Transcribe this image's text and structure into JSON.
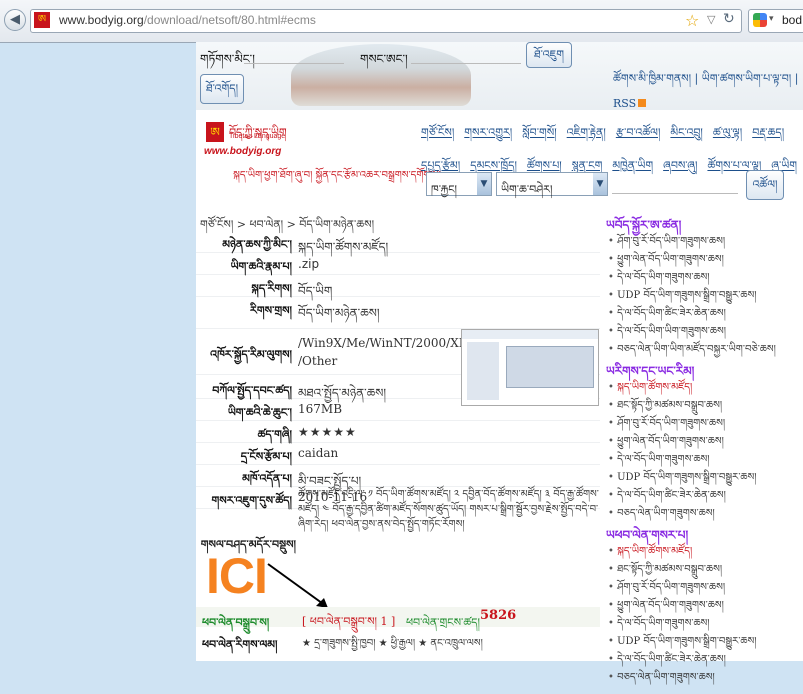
{
  "browser": {
    "url_host": "www.bodyig.org",
    "url_path": "/download/netsoft/80.html#ecms",
    "search_text": "bod",
    "favicon_glyph": "ཨ"
  },
  "header": {
    "user_label": "གཏོགས་མིང་།",
    "pass_label": "གསང་ཨང་།",
    "login_btn": "ཐོ་འཇུག",
    "register_btn": "ཐོ་འགོད།",
    "toplinks": "ཚོགས་མི་ཁྱིམ་གནས། | ཡིག་ཚགས་ཡིག་པ་ལྟ་བ། | RSS"
  },
  "logo": {
    "mark": "ཨ",
    "title": "བོད་ཀྱི་སྐད་ཡིག",
    "subtitle": "Tibetan Language",
    "url": "www.bodyig.org"
  },
  "nav": {
    "row1": [
      "གཙོ་ངོས།",
      "གསར་འགྱུར།",
      "སློབ་གསོ།",
      "འཇིག་རྟེན།",
      "རྩ་བ་འཚོལ།",
      "མིང་འབྲུ།",
      "ཚ་ལུ་ལྟ།",
      "བརྡ་ཆད།"
    ],
    "row2": [
      "དཔྱད་རྩོམ།",
      "དམངས་ཁྲོད།",
      "ཚོགས་པ།",
      "སྙན་ངག",
      "མཁྱེན་ཡིག",
      "ཞབས་ཞུ།",
      "ཚོགས་པ་ལ་ལྟ།",
      "ཞུ་ཡིག"
    ]
  },
  "announcement": "སྐད་ཡིག་ཕྱག་ཐོག་ཞུ་བ། སྐྱོན་དང་རྩོམ་འཆར་བསྒྲགས་དགོས་པ།",
  "search": {
    "cat_value": "ཁ་རྐྱང།",
    "field_value": "ཡིག་ཆ་བཤེར།",
    "go_btn": "འཚོལ།"
  },
  "breadcrumb": "གཙོ་ངོས། > ཕབ་ལེན། > བོད་ཡིག་མཉེན་ཆས།",
  "details": {
    "rows": [
      {
        "k": "མཉེན་ཆས་ཀྱི་མིང་།",
        "v": "སྐད་ཡིག་ཚོགས་མཛོད།"
      },
      {
        "k": "ཡིག་ཆའི་རྣམ་པ།",
        "v": ".zip"
      },
      {
        "k": "སྐད་རིགས།",
        "v": "བོད་ཡིག"
      },
      {
        "k": "རིགས་གྲས།",
        "v": "བོད་ཡིག་མཉེན་ཆས།"
      },
      {
        "k": "འཁོར་སྐྱོད་རིམ་ལུགས།",
        "v": "/Win9X/Me/WinNT/2000/XP /Other"
      },
      {
        "k": "བཀོལ་སྤྱོད་དབང་ཚད།",
        "v": "མཐའ་སྤྱོད་མཉེན་ཆས།"
      },
      {
        "k": "ཡིག་ཆའི་ཆེ་ཆུང་།",
        "v": "167MB"
      },
      {
        "k": "ཚད་གཞི།",
        "v": "★★★★★"
      },
      {
        "k": "དྲ་ངོས་རྩོམ་པ།",
        "v": "caidan"
      },
      {
        "k": "མཁོ་འདོན་པ།",
        "v": "མི་བཟང་སྤྱོད་པ།"
      },
      {
        "k": "གསར་འཇུག་དུས་ཚོད།",
        "v": "2010-11-16"
      }
    ],
    "intro_label": "གསལ་བཤད་མདོར་བསྡུས།",
    "intro_text": "ཚོགས་མཛོད་འདི་ལ་ ༡ བོད་ཡིག་ཚོགས་མཛོད། ༢ དབྱིན་བོད་ཚོགས་མཛོད། ༣ བོད་རྒྱ་ཚོགས་མཛོད། ༤ བོད་རྒྱ་དབྱིན་ཚིག་མཛོད་སོགས་ཚུད་ཡོད། གསར་པ་སྒྲིག་སྦྱོར་བྱས་རྗེས་སྤྱོད་བདེ་བ་ཞིག་རེད། ཕབ་ལེན་བྱས་ནས་བེད་སྤྱོད་གཏོང་རོགས།",
    "ici": "ICI",
    "download_label": "ཕབ་ལེན་བསྒྲུབ་ས།",
    "download_link": "[ ཕབ་ལེན་བསྒྲུབ་ས། 1 ]",
    "download_count_label": "ཕབ་ལེན་གྲངས་ཚད།",
    "download_count": "5826",
    "mirror_label": "ཕབ་ལེན་རིགས་ལམ།",
    "mirror_text": "★ དྲ་གཟུགས་སྤྱི་ཁྱབ། ★ ཕྱི་རྒྱལ། ★ ནང་འཁྲུལ་ལས།"
  },
  "side": {
    "sec1_title": "ཡབོད་སྐྱོར་ཨ་ཚན།",
    "sec1": [
      "ཤོག་བུ་རོ་བོད་ཡིག་གཟུགས་ཆས།",
      "ཕྱུག་ལེན་བོད་ཡིག་གཟུགས་ཆས།",
      "དེ་ལ་བོད་ཡིག་གཟུགས་ཆས།",
      "UDP བོད་ཡིག་གཟུགས་སྒྲིག་བསྒྱུར་ཆས།",
      "དེ་ལ་བོད་ཡིག་ཚིང་ཟེར་ཆེན་ཆས།",
      "དེ་ལ་བོད་ཡིག་ཡིག་གཟུགས་ཆས།",
      "བཅད་ལེན་ཡིག་ཡིག་མཛོད་བསྐྱར་ཡིག་བཅེ་ཆས།"
    ],
    "sec2_title": "ཡརིགས་དང་ཡང་རིམ།",
    "sec2": [
      "སྐད་ཡིག་ཚོགས་མཛོད།",
      "ཐང་སྟོད་ཀྱི་མཚམས་བསྒྲུབ་ཆས།",
      "ཤོག་བུ་རོ་བོད་ཡིག་གཟུགས་ཆས།",
      "ཕྱུག་ལེན་བོད་ཡིག་གཟུགས་ཆས།",
      "དེ་ལ་བོད་ཡིག་གཟུགས་ཆས།",
      "UDP བོད་ཡིག་གཟུགས་སྒྲིག་བསྒྱུར་ཆས།",
      "དེ་ལ་བོད་ཡིག་ཚིང་ཟེར་ཆེན་ཆས།",
      "བཅད་ལེན་ཡིག་གཟུགས་ཆས།"
    ],
    "sec3_title": "ཡཕབ་ལེན་གསར་པ།",
    "sec3": [
      "སྐད་ཡིག་ཚོགས་མཛོད།",
      "ཐང་སྟོད་ཀྱི་མཚམས་བསྒྲུབ་ཆས།",
      "ཤོག་བུ་རོ་བོད་ཡིག་གཟུགས་ཆས།",
      "ཕྱུག་ལེན་བོད་ཡིག་གཟུགས་ཆས།",
      "དེ་ལ་བོད་ཡིག་གཟུགས་ཆས།",
      "UDP བོད་ཡིག་གཟུགས་སྒྲིག་བསྒྱུར་ཆས།",
      "དེ་ལ་བོད་ཡིག་ཚིང་ཟེར་ཆེན་ཆས།",
      "བཅད་ལེན་ཡིག་གཟུགས་ཆས།"
    ]
  }
}
